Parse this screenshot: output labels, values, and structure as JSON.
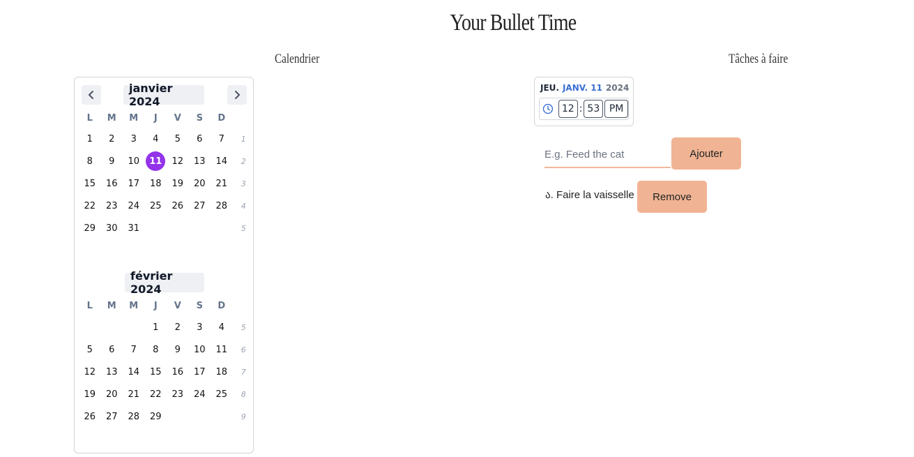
{
  "app": {
    "title": "Your Bullet Time"
  },
  "sections": {
    "calendar_title": "Calendrier",
    "tasks_title": "Tâches à faire"
  },
  "calendar": {
    "weekdays": [
      "L",
      "M",
      "M",
      "J",
      "V",
      "S",
      "D"
    ],
    "months": [
      {
        "label": "janvier 2024",
        "weeks": [
          {
            "days": [
              "1",
              "2",
              "3",
              "4",
              "5",
              "6",
              "7"
            ],
            "weeknum": "1"
          },
          {
            "days": [
              "8",
              "9",
              "10",
              "11",
              "12",
              "13",
              "14"
            ],
            "weeknum": "2"
          },
          {
            "days": [
              "15",
              "16",
              "17",
              "18",
              "19",
              "20",
              "21"
            ],
            "weeknum": "3"
          },
          {
            "days": [
              "22",
              "23",
              "24",
              "25",
              "26",
              "27",
              "28"
            ],
            "weeknum": "4"
          },
          {
            "days": [
              "29",
              "30",
              "31",
              "",
              "",
              "",
              ""
            ],
            "weeknum": "5"
          }
        ]
      },
      {
        "label": "février 2024",
        "weeks": [
          {
            "days": [
              "",
              "",
              "",
              "1",
              "2",
              "3",
              "4"
            ],
            "weeknum": "5"
          },
          {
            "days": [
              "5",
              "6",
              "7",
              "8",
              "9",
              "10",
              "11"
            ],
            "weeknum": "6"
          },
          {
            "days": [
              "12",
              "13",
              "14",
              "15",
              "16",
              "17",
              "18"
            ],
            "weeknum": "7"
          },
          {
            "days": [
              "19",
              "20",
              "21",
              "22",
              "23",
              "24",
              "25"
            ],
            "weeknum": "8"
          },
          {
            "days": [
              "26",
              "27",
              "28",
              "29",
              "",
              "",
              ""
            ],
            "weeknum": "9"
          }
        ]
      }
    ],
    "selected_day": "11",
    "selected_color": "#9333ea"
  },
  "datetime": {
    "weekday": "JEU.",
    "day_month": "JANV. 11",
    "year": "2024",
    "hour": "12",
    "minute": "53",
    "ampm": "PM",
    "separator": ":"
  },
  "task_form": {
    "placeholder": "E.g. Feed the cat",
    "add_label": "Ajouter"
  },
  "tasks": [
    {
      "text": "ა. Faire la vaisselle",
      "remove_label": "Remove"
    }
  ],
  "colors": {
    "accent_button": "#f0b494",
    "date_accent": "#3b6fd4"
  }
}
